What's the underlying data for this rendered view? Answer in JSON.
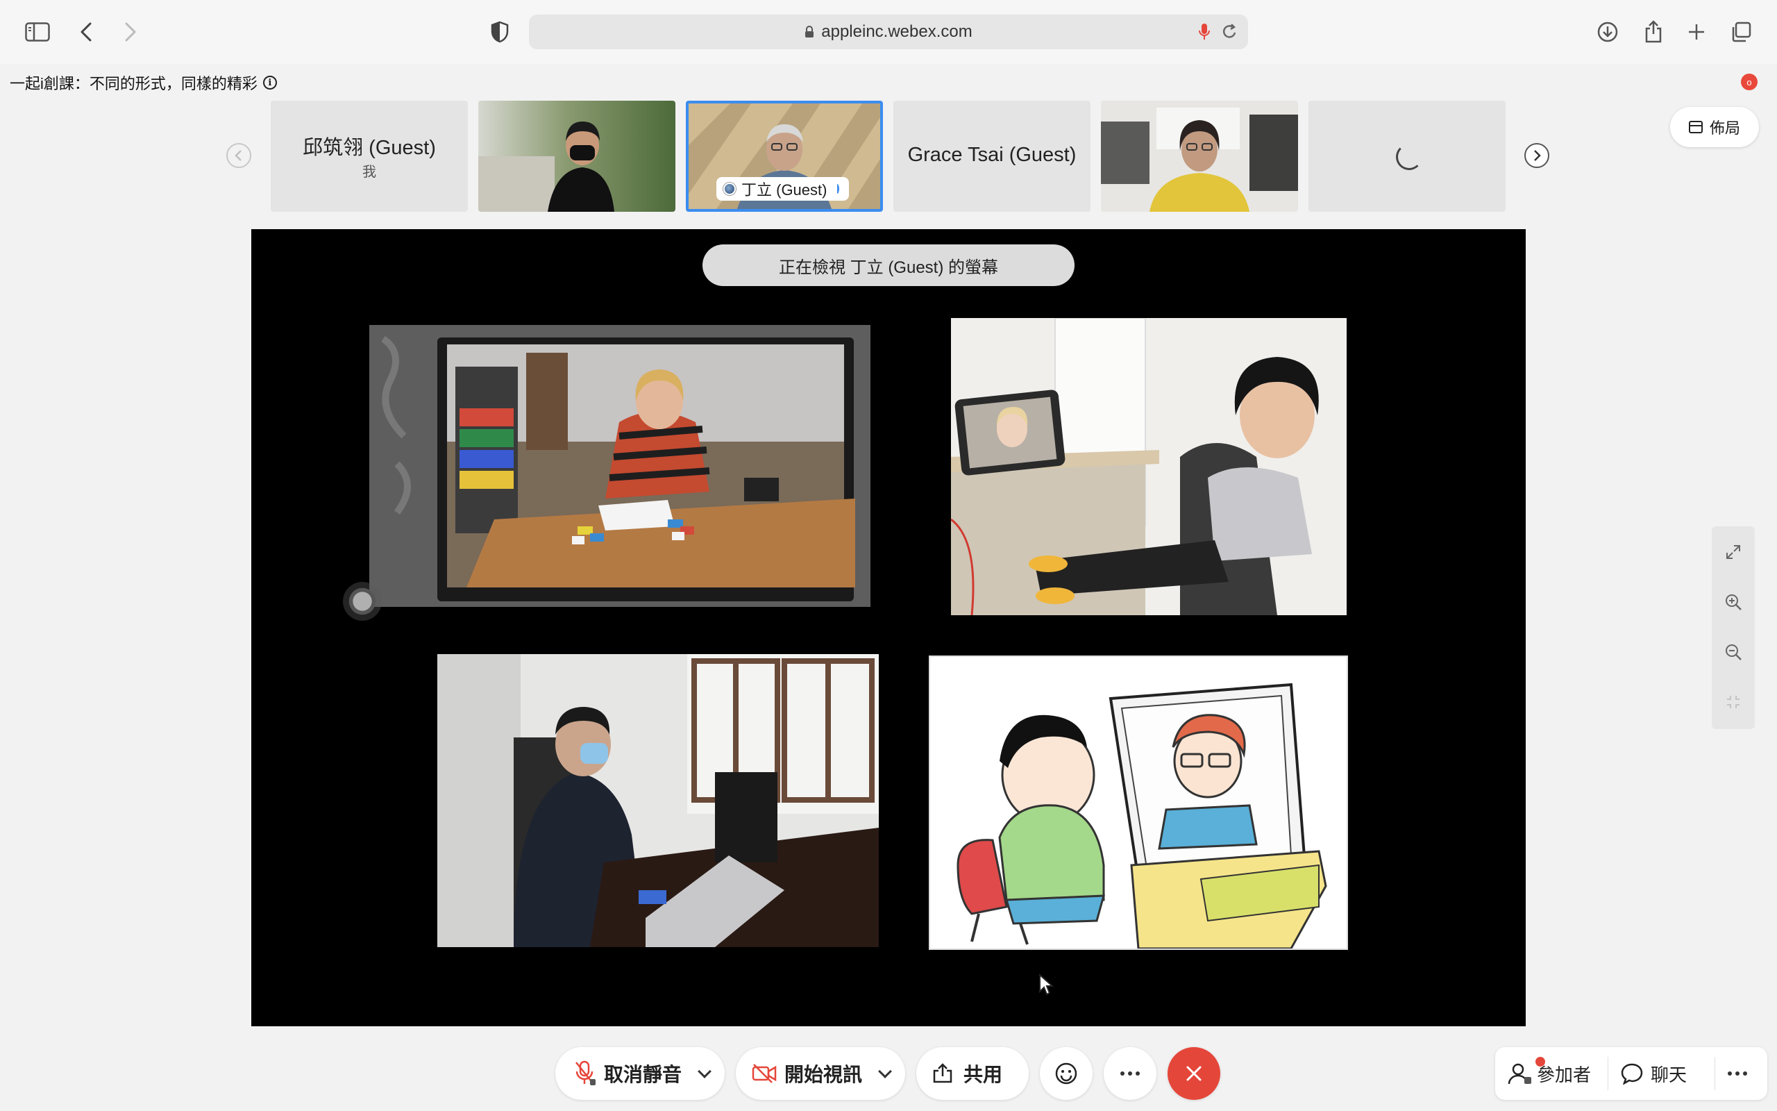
{
  "browser": {
    "url": "appleinc.webex.com"
  },
  "meeting": {
    "title": "一起i創課：不同的形式，同樣的精彩",
    "info_glyph": "i",
    "recording_glyph": "o",
    "layout_label": "佈局"
  },
  "filmstrip": {
    "tiles": [
      {
        "name": "邱筑翎 (Guest)",
        "sub": "我",
        "type": "name"
      },
      {
        "type": "video"
      },
      {
        "name": "丁立 (Guest)",
        "type": "video-active"
      },
      {
        "name": "Grace Tsai (Guest)",
        "type": "name"
      },
      {
        "type": "video"
      },
      {
        "type": "loading"
      }
    ]
  },
  "share": {
    "banner": "正在檢視 丁立 (Guest) 的螢幕"
  },
  "controls": {
    "unmute_label": "取消靜音",
    "video_label": "開始視訊",
    "share_label": "共用",
    "participants_label": "參加者",
    "chat_label": "聊天"
  },
  "colors": {
    "leave_red": "#e5463a",
    "active_blue": "#3b8df0",
    "stage_black": "#000000"
  }
}
